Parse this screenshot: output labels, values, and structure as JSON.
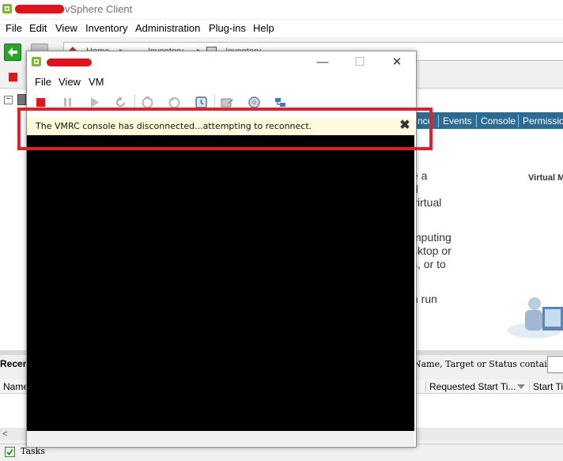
{
  "background_app": {
    "title": "vSphere Client",
    "menu": [
      "File",
      "Edit",
      "View",
      "Inventory",
      "Administration",
      "Plug-ins",
      "Help"
    ],
    "address_segments": [
      "Home",
      "Inventory",
      "Inventory"
    ],
    "tabs": [
      "nce",
      "Events",
      "Console",
      "Permissio"
    ],
    "summary_fragments": [
      "e a",
      "d",
      "virtual",
      "mputing",
      "sktop or",
      "s, or to",
      "n run"
    ],
    "virtual_label": "Virtual M",
    "recent_label": "Recen",
    "filter_label": "Name, Target or Status contains:",
    "filter_dropdown_arrow": "▾",
    "list_columns": [
      "Name",
      "Requested Start Ti...",
      "Start Tir"
    ],
    "scroll_left_glyph": "<",
    "status_tasks_label": "Tasks"
  },
  "vmrc": {
    "menu": [
      "File",
      "View",
      "VM"
    ],
    "window_buttons": {
      "minimize": "—",
      "maximize": "☐",
      "close": "✕"
    },
    "banner": {
      "message": "The VMRC console has disconnected...attempting to reconnect.",
      "close_glyph": "✖"
    },
    "toolbar_icons": [
      "stop-icon",
      "pause-icon",
      "play-icon",
      "reset-icon",
      "snapshot-icon",
      "revert-snapshot-icon",
      "snapshot-manager-icon",
      "edit-settings-icon",
      "cd-dvd-icon",
      "usb-icon"
    ]
  },
  "colors": {
    "highlight": "#e0212b",
    "banner_bg": "#fdfbdc",
    "tab_strip": "#2c6b94",
    "console_bg": "#000000"
  }
}
